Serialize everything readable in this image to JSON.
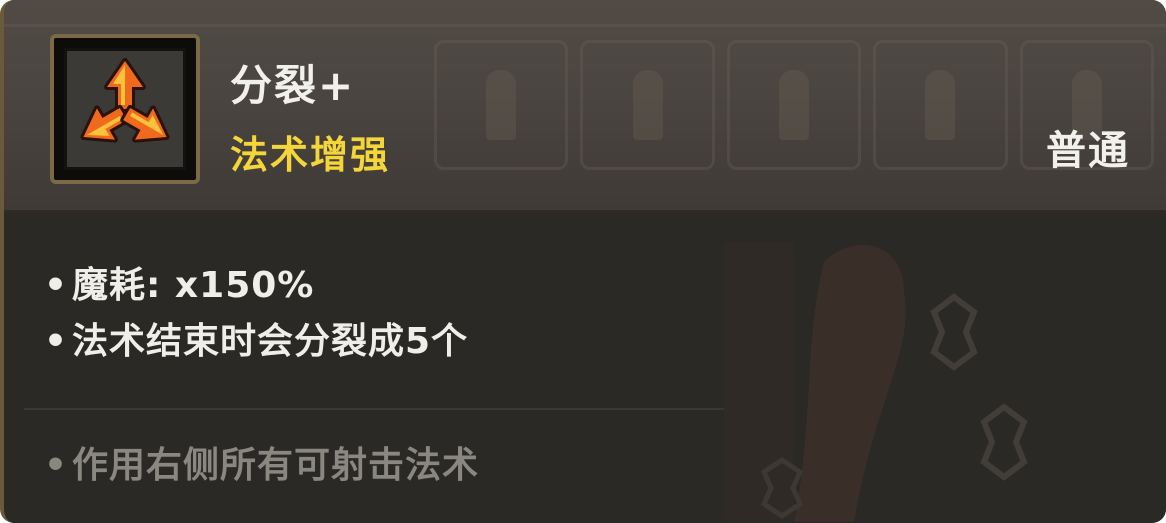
{
  "card": {
    "name": "分裂+",
    "type": "法术增强",
    "rarity": "普通",
    "icon": "triple-split-arrows-icon",
    "colors": {
      "name": "#f2f0ea",
      "type": "#f4d63a",
      "stat": "#f0eee8",
      "note": "#8a8680",
      "arrow_fill": "#f06a1e",
      "arrow_highlight": "#f9c23c"
    }
  },
  "stats": {
    "bullet": "•",
    "mana_cost": "魔耗: x150%",
    "effect": "法术结束时会分裂成5个"
  },
  "note": {
    "bullet": "•",
    "text": "作用右侧所有可射击法术"
  }
}
